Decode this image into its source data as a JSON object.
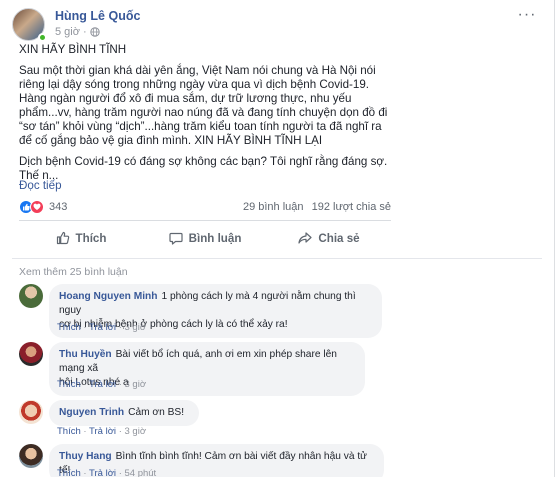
{
  "post": {
    "author": "Hùng Lê Quốc",
    "time": "5 giờ",
    "separator": "·",
    "paragraphs": [
      "XIN HÃY BÌNH TĨNH",
      "Sau một thời gian khá dài yên ắng, Việt Nam nói chung và Hà Nội nói riêng lại dậy sóng trong những ngày vừa qua vì dịch bệnh Covid-19. Hàng ngàn người đổ xô đi mua sắm, dự trữ lương thực, nhu yếu phẩm...vv, hàng trăm người nao núng đã và đang tính chuyện dọn đồ đi “sơ tán” khỏi vùng “dịch”...hàng trăm kiểu toan tính người ta đã nghĩ ra để cố gắng bảo vệ gia đình mình. XIN HÃY BÌNH TĨNH LẠI",
      "Dịch bệnh Covid-19 có đáng sợ không các bạn? Tôi nghĩ rằng đáng sợ. Thế n..."
    ],
    "see_more": "Đọc tiếp",
    "reaction_count": "343",
    "comment_count": "29 bình luận",
    "share_count": "192 lượt chia sẻ"
  },
  "actions": {
    "like": "Thích",
    "comment": "Bình luận",
    "share": "Chia sẻ"
  },
  "comments": {
    "view_more": "Xem thêm 25 bình luận",
    "items": [
      {
        "name": "Hoang Nguyen Minh",
        "line1": "1 phòng cách ly mà 4 người nằm chung thì nguy",
        "line2": "cơ bị nhiễm bệnh ở phòng cách ly là có thể xảy ra!",
        "like": "Thích",
        "reply": "Trả lời",
        "time": "3 giờ",
        "dot": "·"
      },
      {
        "name": "Thu Huyền",
        "line1": "Bài viết bổ ích quá, anh ơi em xin phép share lên mạng xã",
        "line2": "hội Lotus nhé ạ",
        "like": "Thích",
        "reply": "Trả lời",
        "time": "3 giờ",
        "dot": "·"
      },
      {
        "name": "Nguyen Trinh",
        "line1": "Cảm ơn BS!",
        "line2": "",
        "like": "Thích",
        "reply": "Trả lời",
        "time": "3 giờ",
        "dot": "·"
      },
      {
        "name": "Thuy Hang",
        "line1": "Bình tĩnh bình tĩnh! Cảm ơn bài viết đầy nhân hậu và tử tế!",
        "line2": "",
        "like": "Thích",
        "reply": "Trả lời",
        "time": "54 phút",
        "dot": "·"
      }
    ]
  },
  "colors": {
    "link": "#385898",
    "muted": "#90949c",
    "like_blue": "#1877f2",
    "love_red": "#f33e58",
    "bubble": "#f2f3f5"
  }
}
